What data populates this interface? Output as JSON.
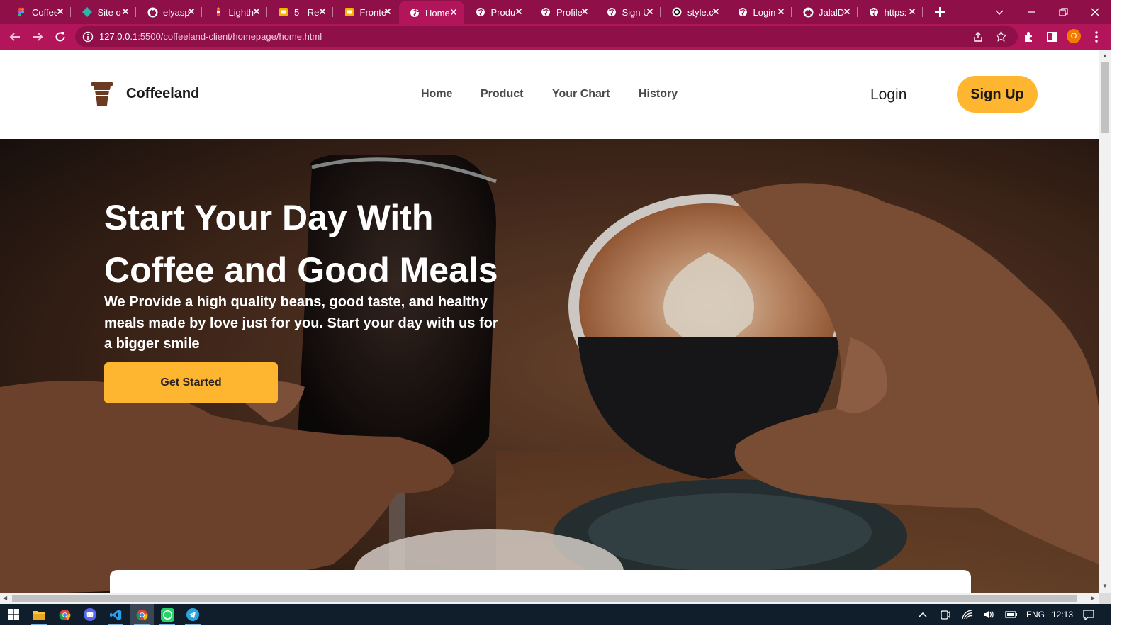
{
  "browser": {
    "tabs": [
      {
        "title": "Coffee",
        "icon": "figma-icon"
      },
      {
        "title": "Site o",
        "icon": "netlify-icon"
      },
      {
        "title": "elyasp",
        "icon": "github-icon"
      },
      {
        "title": "Lighth",
        "icon": "lighthouse-icon"
      },
      {
        "title": "5 - Re",
        "icon": "slides-icon"
      },
      {
        "title": "Fronte",
        "icon": "slides-icon"
      },
      {
        "title": "Home",
        "icon": "globe-icon",
        "active": true
      },
      {
        "title": "Produ",
        "icon": "globe-icon"
      },
      {
        "title": "Profile",
        "icon": "globe-icon"
      },
      {
        "title": "Sign U",
        "icon": "globe-icon"
      },
      {
        "title": "style.c",
        "icon": "openai-icon"
      },
      {
        "title": "Login",
        "icon": "globe-icon"
      },
      {
        "title": "JalalD",
        "icon": "github-icon"
      },
      {
        "title": "https:",
        "icon": "globe-icon"
      }
    ],
    "url_host": "127.0.0.1",
    "url_path": ":5500/coffeeland-client/homepage/home.html",
    "profile_initial": "O",
    "colors": {
      "frame": "#8f0f48",
      "toolbar": "#b3155b"
    }
  },
  "page": {
    "brand": {
      "name": "Coffeeland",
      "icon": "coffee-cup-icon"
    },
    "nav": {
      "links": [
        "Home",
        "Product",
        "Your Chart",
        "History"
      ],
      "login": "Login",
      "signup": "Sign Up"
    },
    "hero": {
      "title_line1": "Start Your Day With",
      "title_line2": "Coffee and Good Meals",
      "description": "We Provide a high quality beans, good taste, and healthy meals made by love just for you. Start your day with us for a bigger smile",
      "cta": "Get Started"
    },
    "colors": {
      "accent": "#feb52f",
      "text_dark": "#1c1a1a",
      "nav_text": "#4a4848"
    }
  },
  "taskbar": {
    "apps": [
      "windows-start-icon",
      "file-explorer-icon",
      "chrome-icon",
      "discord-icon",
      "vscode-icon",
      "chrome-icon",
      "whatsapp-icon",
      "telegram-icon"
    ],
    "language": "ENG",
    "time": "12:13"
  }
}
